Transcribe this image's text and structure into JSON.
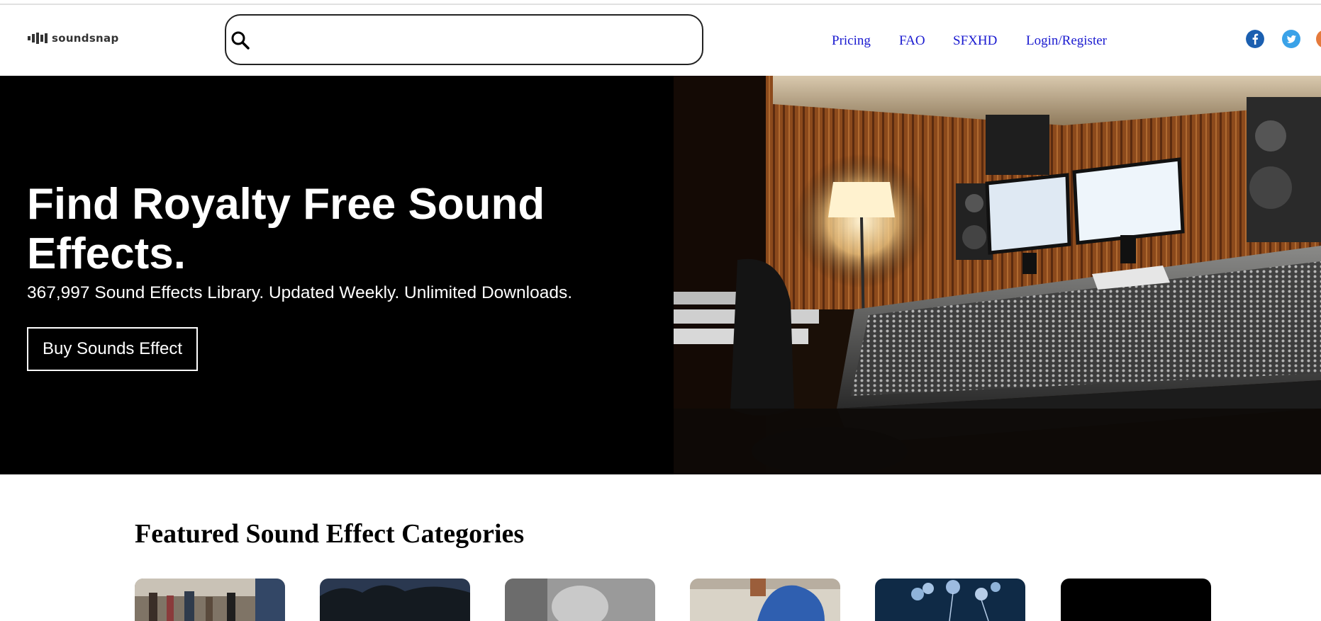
{
  "header": {
    "logo_text": "soundsnap",
    "search": {
      "placeholder": "",
      "value": ""
    },
    "nav": [
      {
        "label": "Pricing"
      },
      {
        "label": "FAO"
      },
      {
        "label": "SFXHD"
      },
      {
        "label": "Login/Register"
      }
    ],
    "social": [
      {
        "icon": "facebook-icon",
        "color": "#1b5fb0"
      },
      {
        "icon": "twitter-icon",
        "color": "#3aa2e8"
      }
    ]
  },
  "hero": {
    "title": "Find Royalty Free Sound Effects.",
    "subtitle": "367,997 Sound Effects Library. Updated Weekly. Unlimited Downloads.",
    "cta_label": "Buy Sounds Effect",
    "image": "recording-studio-mixing-console"
  },
  "featured": {
    "title": "Featured Sound Effect Categories",
    "cards": [
      {
        "image": "street-crowd-thumbnail"
      },
      {
        "image": "night-trees-thumbnail"
      },
      {
        "image": "grayscale-portrait-thumbnail"
      },
      {
        "image": "person-blue-shirt-thumbnail"
      },
      {
        "image": "fireworks-thumbnail"
      },
      {
        "image": "black-thumbnail"
      }
    ]
  },
  "colors": {
    "link": "#1a1ad0",
    "hero_bg": "#000000",
    "accent_text": "#ffffff"
  }
}
